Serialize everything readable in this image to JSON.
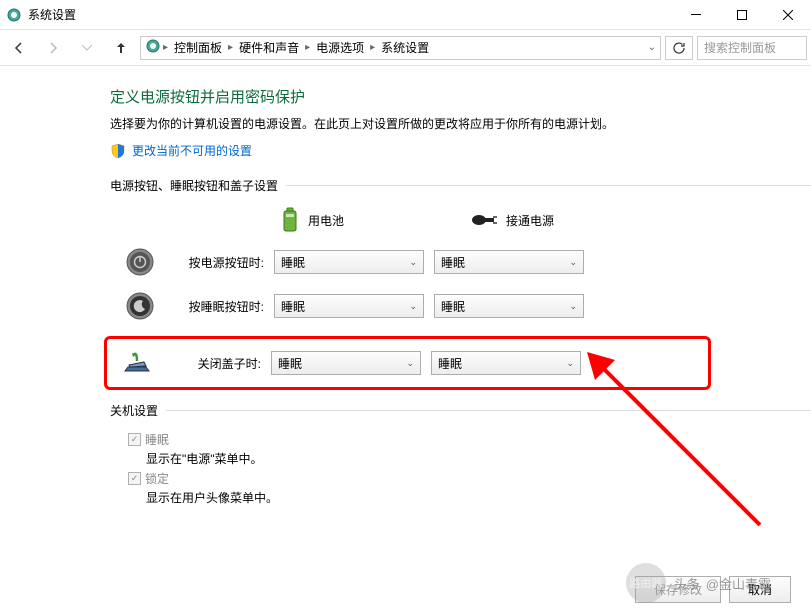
{
  "window": {
    "title": "系统设置"
  },
  "breadcrumb": {
    "items": [
      "控制面板",
      "硬件和声音",
      "电源选项",
      "系统设置"
    ]
  },
  "search": {
    "placeholder": "搜索控制面板"
  },
  "page": {
    "title": "定义电源按钮并启用密码保护",
    "description": "选择要为你的计算机设置的电源设置。在此页上对设置所做的更改将应用于你所有的电源计划。",
    "shield_link": "更改当前不可用的设置"
  },
  "buttons_section": {
    "title": "电源按钮、睡眠按钮和盖子设置",
    "columns": {
      "battery": "用电池",
      "plugged": "接通电源"
    },
    "rows": [
      {
        "label": "按电源按钮时:",
        "battery": "睡眠",
        "plugged": "睡眠",
        "icon": "power"
      },
      {
        "label": "按睡眠按钮时:",
        "battery": "睡眠",
        "plugged": "睡眠",
        "icon": "sleep"
      },
      {
        "label": "关闭盖子时:",
        "battery": "睡眠",
        "plugged": "睡眠",
        "icon": "lid",
        "highlighted": true
      }
    ]
  },
  "shutdown_section": {
    "title": "关机设置",
    "items": [
      {
        "label": "睡眠",
        "desc": "显示在\"电源\"菜单中。",
        "checked": true
      },
      {
        "label": "锁定",
        "desc": "显示在用户头像菜单中。",
        "checked": true
      }
    ]
  },
  "footer": {
    "save": "保存修改",
    "cancel": "取消"
  },
  "watermark": {
    "prefix": "头条",
    "text": "@金山毒霸",
    "badge": "路由器"
  }
}
